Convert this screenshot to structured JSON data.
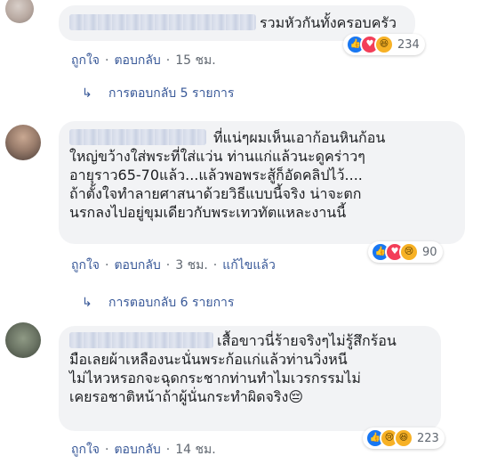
{
  "comments": [
    {
      "text_lines": [
        "รวมหัวกันทั้งครอบครัว"
      ],
      "reactions": {
        "icons": [
          "like-icon",
          "love-icon",
          "haha-icon"
        ],
        "count": "234"
      },
      "actions": {
        "like": "ถูกใจ",
        "reply": "ตอบกลับ",
        "time": "15 ชม."
      },
      "replies_label": "การตอบกลับ 5 รายการ"
    },
    {
      "text_lines": [
        "ที่แน่ๆผมเห็นเอาก้อนหินก้อน",
        "ใหญ่ขว้างใส่พระที่ใส่แว่น ท่านแก่แล้วนะดูคร่าวๆ",
        "อายุราว65-70แล้ว...แล้วพอพระสู้ก็อัดคลิปไว้....",
        "ถ้าตั้งใจทำลายศาสนาด้วยวิธีแบบนี้จริง น่าจะตก",
        "นรกลงไปอยู่ขุมเดียวกับพระเทวทัตแหละงานนี้"
      ],
      "reactions": {
        "icons": [
          "like-icon",
          "love-icon",
          "sad-icon"
        ],
        "count": "90"
      },
      "actions": {
        "like": "ถูกใจ",
        "reply": "ตอบกลับ",
        "time": "3 ชม.",
        "edited": "แก้ไขแล้ว"
      },
      "replies_label": "การตอบกลับ 6 รายการ"
    },
    {
      "text_lines": [
        "เสื้อขาวนี่ร้ายจริงๆไม่รู้สึกร้อน",
        "มือเลยผ้าเหลืองนะนั่นพระก้อแก่แล้วท่านวิ่งหนี",
        "ไม่ไหวหรอกจะฉุดกระชากท่านทำไมเวรกรรมไม่",
        "เคยรอชาติหน้าถ้าผู้นั่นกระทำผิดจริง😔"
      ],
      "reactions": {
        "icons": [
          "like-icon",
          "sad-icon",
          "haha-icon"
        ],
        "count": "223"
      },
      "actions": {
        "like": "ถูกใจ",
        "reply": "ตอบกลับ",
        "time": "14 ชม."
      }
    }
  ],
  "glyphs": {
    "like": "👍",
    "love": "♥",
    "haha": "😆",
    "sad": "😢",
    "reply_arrow": "↳",
    "separator": "·"
  }
}
